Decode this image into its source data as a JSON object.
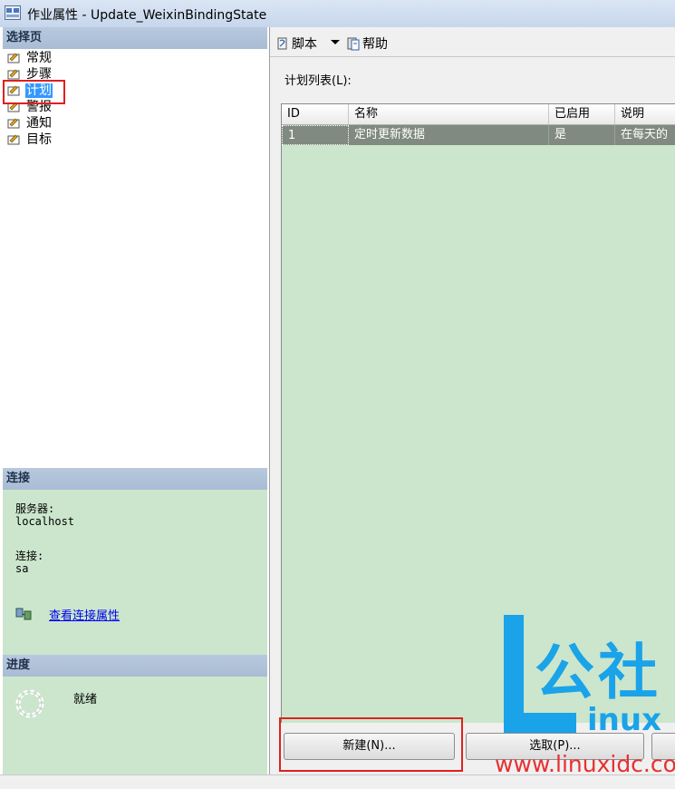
{
  "window": {
    "title": "作业属性 - Update_WeixinBindingState"
  },
  "sidebar": {
    "header": "选择页",
    "items": [
      {
        "label": "常规"
      },
      {
        "label": "步骤"
      },
      {
        "label": "计划",
        "selected": true
      },
      {
        "label": "警报"
      },
      {
        "label": "通知"
      },
      {
        "label": "目标"
      }
    ]
  },
  "connection": {
    "header": "连接",
    "server_label": "服务器:",
    "server_value": "localhost",
    "conn_label": "连接:",
    "conn_value": "sa",
    "link": "查看连接属性"
  },
  "progress": {
    "header": "进度",
    "status": "就绪"
  },
  "toolbar": {
    "script": "脚本",
    "help": "帮助"
  },
  "schedule_list": {
    "label": "计划列表(L):",
    "columns": [
      "ID",
      "名称",
      "已启用",
      "说明"
    ],
    "rows": [
      {
        "id": "1",
        "name": "定时更新数据",
        "enabled": "是",
        "desc": "在每天的"
      }
    ]
  },
  "buttons": {
    "new": "新建(N)...",
    "pick": "选取(P)..."
  },
  "watermark": {
    "cn": "公社",
    "linux": "inux",
    "url": "www.linuxidc.com"
  },
  "colors": {
    "accent": "#1aa3e8",
    "panel_green": "#cbe6cc",
    "selection": "#3399ff",
    "highlight": "#e02020"
  }
}
